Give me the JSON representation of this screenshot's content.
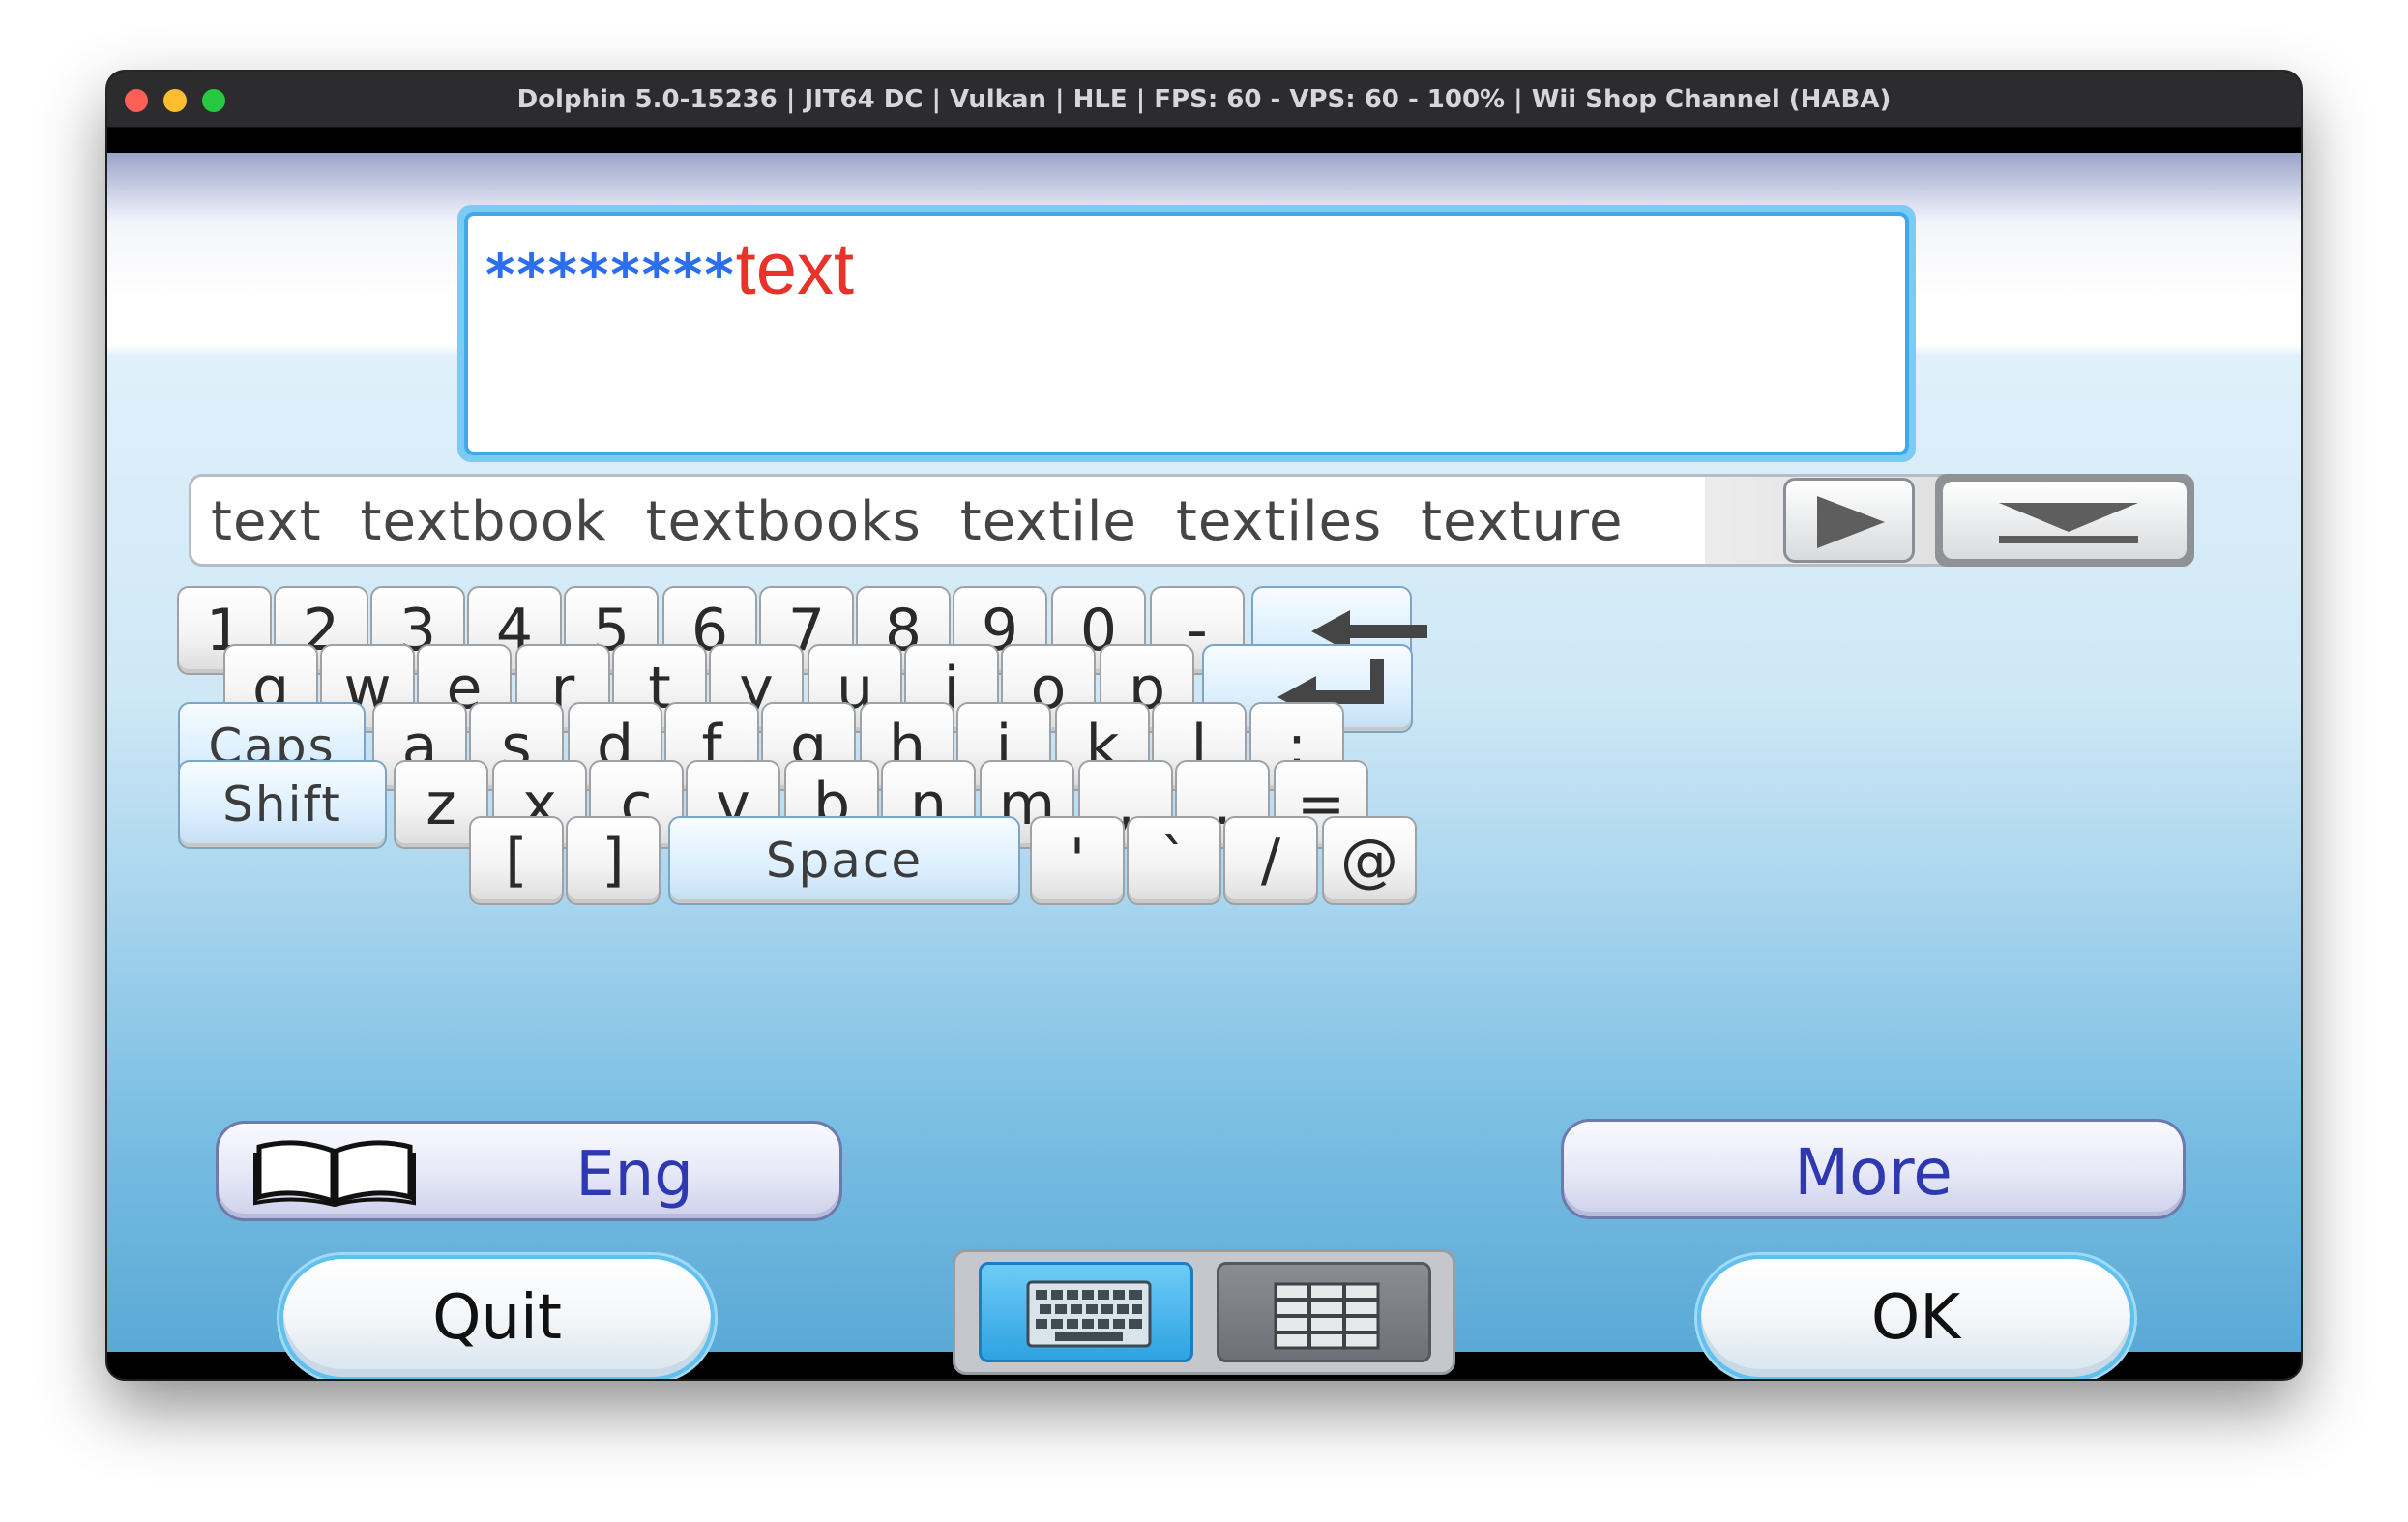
{
  "window": {
    "title": "Dolphin 5.0-15236 | JIT64 DC | Vulkan | HLE | FPS: 60 - VPS: 60 - 100% | Wii Shop Channel (HABA)"
  },
  "input": {
    "masked": "********",
    "composing": "text"
  },
  "suggestions": [
    "text",
    "textbook",
    "textbooks",
    "textile",
    "textiles",
    "texture"
  ],
  "keys": {
    "row1": [
      "1",
      "2",
      "3",
      "4",
      "5",
      "6",
      "7",
      "8",
      "9",
      "0",
      "-"
    ],
    "row2": [
      "q",
      "w",
      "e",
      "r",
      "t",
      "y",
      "u",
      "i",
      "o",
      "p"
    ],
    "row3": [
      "a",
      "s",
      "d",
      "f",
      "g",
      "h",
      "j",
      "k",
      "l",
      ":"
    ],
    "row4": [
      "z",
      "x",
      "c",
      "v",
      "b",
      "n",
      "m",
      ",",
      ".",
      "="
    ],
    "row5_left": [
      "[",
      "]"
    ],
    "row5_right": [
      "'",
      "`",
      "/",
      "@"
    ],
    "caps": "Caps",
    "shift": "Shift",
    "space": "Space"
  },
  "language": "Eng",
  "more": "More",
  "quit": "Quit",
  "ok": "OK",
  "colors": {
    "masked_text": "#2b6ff0",
    "composing_text": "#e8322a",
    "accent": "#41a9e9",
    "label_blue": "#2e38b0"
  },
  "icons": {
    "next": "play-arrow-icon",
    "collapse": "collapse-down-icon",
    "backspace": "backspace-arrow-icon",
    "enter": "enter-arrow-icon",
    "dictionary": "open-book-icon",
    "keyboard_mode": "keyboard-icon",
    "grid_mode": "grid-icon"
  }
}
